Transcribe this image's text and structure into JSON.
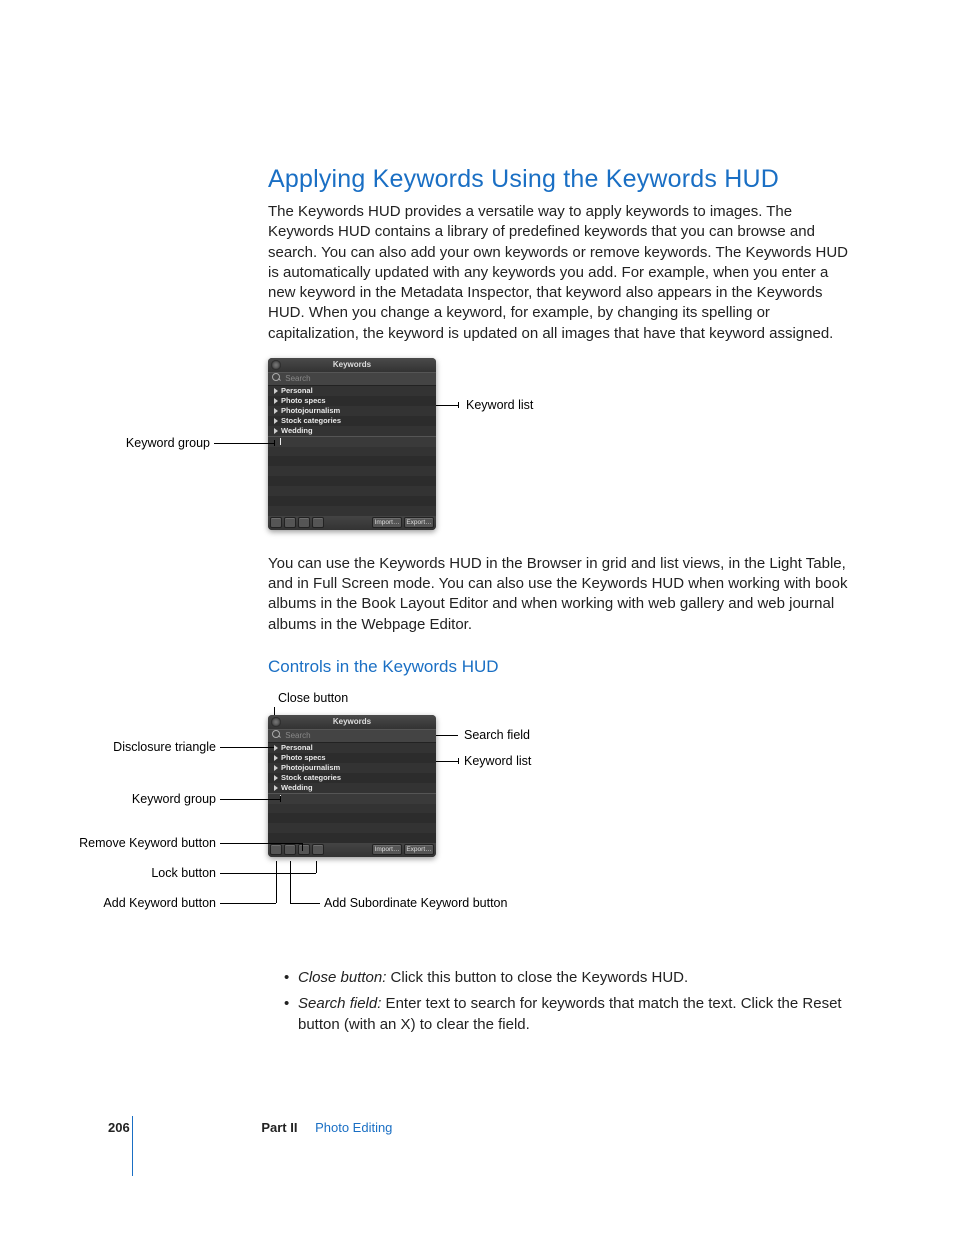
{
  "title": "Applying Keywords Using the Keywords HUD",
  "para1": "The Keywords HUD provides a versatile way to apply keywords to images. The Keywords HUD contains a library of predefined keywords that you can browse and search. You can also add your own keywords or remove keywords. The Keywords HUD is automatically updated with any keywords you add. For example, when you enter a new keyword in the Metadata Inspector, that keyword also appears in the Keywords HUD. When you change a keyword, for example, by changing its spelling or capitalization, the keyword is updated on all images that have that keyword assigned.",
  "para2": "You can use the Keywords HUD in the Browser in grid and list views, in the Light Table, and in Full Screen mode. You can also use the Keywords HUD when working with book albums in the Book Layout Editor and when working with web gallery and web journal albums in the Webpage Editor.",
  "section2_title": "Controls in the Keywords HUD",
  "hud": {
    "title": "Keywords",
    "search_placeholder": "Search",
    "items": [
      "Personal",
      "Photo specs",
      "Photojournalism",
      "Stock categories",
      "Wedding"
    ],
    "import_label": "Import…",
    "export_label": "Export…"
  },
  "callouts1": {
    "keyword_list": "Keyword list",
    "keyword_group": "Keyword group"
  },
  "callouts2": {
    "close_button": "Close button",
    "search_field": "Search field",
    "disclosure_triangle": "Disclosure triangle",
    "keyword_list": "Keyword list",
    "keyword_group": "Keyword group",
    "remove_keyword": "Remove Keyword button",
    "lock_button": "Lock button",
    "add_keyword": "Add Keyword button",
    "add_subordinate": "Add Subordinate Keyword button"
  },
  "bullets": [
    {
      "term": "Close button:",
      "desc": "  Click this button to close the Keywords HUD."
    },
    {
      "term": "Search field:",
      "desc": "  Enter text to search for keywords that match the text. Click the Reset button (with an X) to clear the field."
    }
  ],
  "footer": {
    "page": "206",
    "part_label": "Part II",
    "part_name": "Photo Editing"
  }
}
